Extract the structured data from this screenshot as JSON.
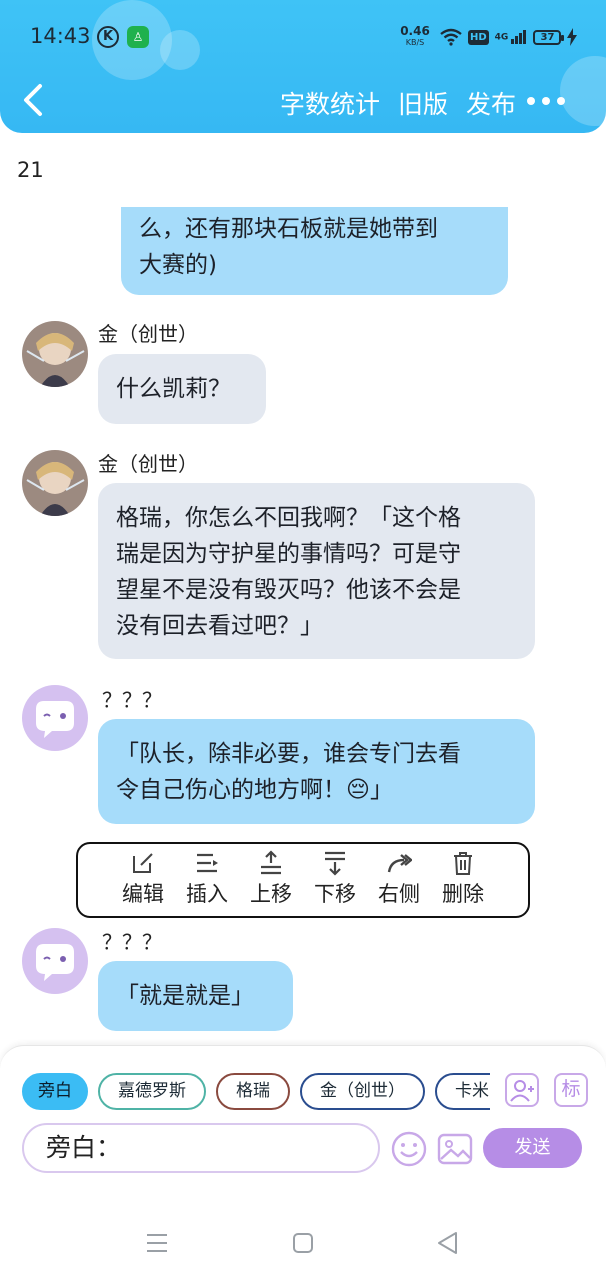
{
  "status_bar": {
    "time": "14:43",
    "k_icon": "K",
    "net_speed": "0.46",
    "net_unit": "KB/S",
    "hd": "HD",
    "signal": "4G",
    "battery": "37"
  },
  "header": {
    "word_count": "字数统计",
    "old_version": "旧版",
    "publish": "发布"
  },
  "chapter_count": "21",
  "messages": [
    {
      "text_line1": "么，还有那块石板就是她带到",
      "text_line2": "大赛的)"
    },
    {
      "name": "金（创世）",
      "text": "什么凯莉？"
    },
    {
      "name": "金（创世）",
      "lines": [
        "格瑞，你怎么不回我啊？「这个格",
        "瑞是因为守护星的事情吗？可是守",
        "望星不是没有毁灭吗？他该不会是",
        "没有回去看过吧？」"
      ]
    },
    {
      "name": "？？？",
      "lines": [
        "「队长，除非必要，谁会专门去看",
        "令自己伤心的地方啊！😔」"
      ]
    },
    {
      "name": "？？？",
      "text": "「就是就是」"
    }
  ],
  "toolbar": {
    "edit": "编辑",
    "insert": "插入",
    "move_up": "上移",
    "move_down": "下移",
    "right": "右侧",
    "delete": "删除"
  },
  "characters": [
    "旁白",
    "嘉德罗斯",
    "格瑞",
    "金（创世）",
    "卡米"
  ],
  "side_icons": {
    "label_btn": "标"
  },
  "input": {
    "value": "旁白："
  },
  "send_label": "发送",
  "colors": {
    "header": "#3fc3f6",
    "bubble_blue": "#a6dcfa",
    "bubble_gray": "#e3e8f0",
    "send": "#b68de6"
  }
}
